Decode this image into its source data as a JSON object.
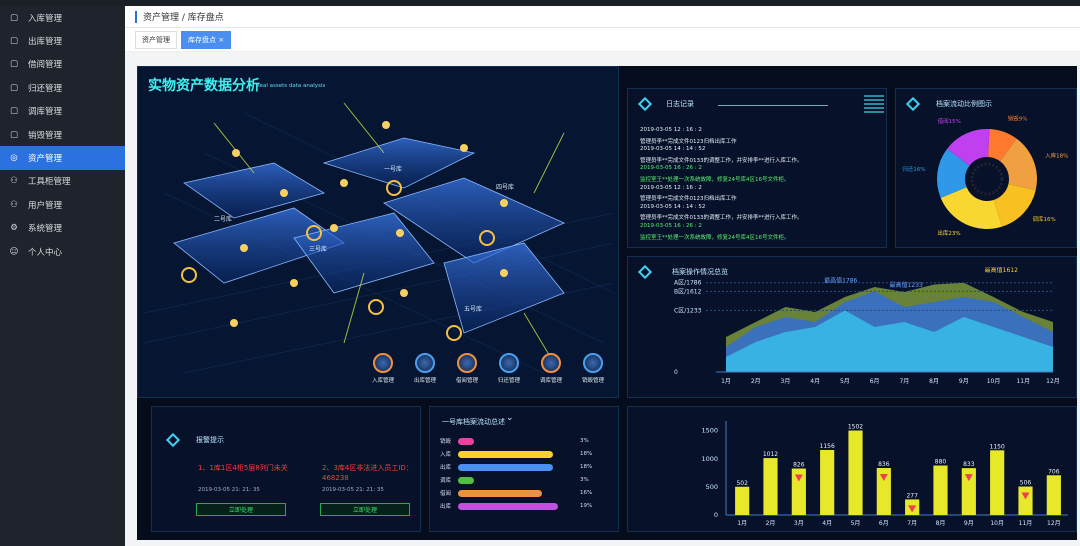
{
  "sidebar": {
    "items": [
      {
        "label": "入库管理",
        "icon": "box-icon"
      },
      {
        "label": "出库管理",
        "icon": "box-icon"
      },
      {
        "label": "借阅管理",
        "icon": "box-icon"
      },
      {
        "label": "归还管理",
        "icon": "box-icon"
      },
      {
        "label": "调库管理",
        "icon": "box-icon"
      },
      {
        "label": "销毁管理",
        "icon": "box-icon"
      },
      {
        "label": "资产管理",
        "icon": "asset-icon",
        "active": true
      },
      {
        "label": "工具柜管理",
        "icon": "user-icon"
      },
      {
        "label": "用户管理",
        "icon": "user-icon"
      },
      {
        "label": "系统管理",
        "icon": "gear-icon"
      },
      {
        "label": "个人中心",
        "icon": "person-icon"
      }
    ]
  },
  "breadcrumb": "资产管理 / 库存盘点",
  "tabs": [
    {
      "label": "资产管理"
    },
    {
      "label": "库存盘点 ×",
      "active": true
    }
  ],
  "dashboard": {
    "title": "实物资产数据分析",
    "subtitle": "Real assets data analysis",
    "map_labels": [
      "一号库",
      "二号库",
      "三号库",
      "四号库",
      "五号库"
    ],
    "map_buttons": [
      "入库管理",
      "出库管理",
      "借阅管理",
      "归还管理",
      "调库管理",
      "销毁管理"
    ],
    "log": {
      "title": "日志记录",
      "lines": [
        {
          "t": "2019-03-05  12 : 16 : 2",
          "g": false
        },
        {
          "t": "管理员李**完成文件0123归档出库工作",
          "g": false
        },
        {
          "t": "2019-03-05  14 : 14 : 52",
          "g": false
        },
        {
          "t": "管理员李**完成文件0133的调整工作，并安排李**进行入库工作。",
          "g": false
        },
        {
          "t": "2019-03-05  16 : 26 : 2",
          "g": true
        },
        {
          "t": "监控室王**处理一次系统故障，修复24号库4区16号文件柜。",
          "g": true
        },
        {
          "t": "2019-03-05  12 : 16 : 2",
          "g": false
        },
        {
          "t": "管理员李**完成文件0123归档出库工作",
          "g": false
        },
        {
          "t": "2019-03-05  14 : 14 : 52",
          "g": false
        },
        {
          "t": "管理员李**完成文件0133的调整工作，并安排李**进行入库工作。",
          "g": false
        },
        {
          "t": "2019-03-05  16 : 26 : 2",
          "g": true
        },
        {
          "t": "监控室王**处理一次系统故障，修复24号库4区16号文件柜。",
          "g": true
        }
      ]
    },
    "pie_title": "档案流动比例图示",
    "line_title": "档案操作情况总览",
    "warn": {
      "title": "报警提示",
      "items": [
        {
          "text": "1、1库1区4柜5层8列门未关",
          "time": "2019-03-05  21: 21: 35",
          "btn": "立即处理"
        },
        {
          "text": "2、3库4区非法进入员工ID：468238",
          "time": "2019-03-05  21: 21: 35",
          "btn": "立即处理"
        }
      ]
    },
    "hbar_title": "一号库档案流动总述"
  },
  "chart_data": [
    {
      "type": "pie",
      "title": "档案流动比例图示",
      "labels": [
        "销毁",
        "入库",
        "调库",
        "出库",
        "归还",
        "借阅"
      ],
      "values": [
        9,
        18,
        16,
        23,
        16,
        15
      ],
      "value_labels": [
        "销毁9%",
        "入库18%",
        "调库16%",
        "出库23%",
        "归还16%",
        "借阅15%"
      ],
      "colors": [
        "#ff7a2e",
        "#f0a040",
        "#f8c020",
        "#f8d830",
        "#3098e8",
        "#c040f0"
      ]
    },
    {
      "type": "area",
      "title": "档案操作情况总览",
      "categories": [
        "1月",
        "2月",
        "3月",
        "4月",
        "5月",
        "6月",
        "7月",
        "8月",
        "9月",
        "10月",
        "11月",
        "12月"
      ],
      "ytick_labels": [
        "A区/1786",
        "B区/1612",
        "C区/1233",
        "0"
      ],
      "annotations": [
        "最高值1786",
        "最高值1233",
        "最高值1612"
      ],
      "series": [
        {
          "values": [
            700,
            1000,
            1300,
            1200,
            1500,
            1700,
            1600,
            1750,
            1786,
            1500,
            1200,
            1000
          ]
        },
        {
          "values": [
            500,
            900,
            1100,
            1000,
            1400,
            1612,
            1300,
            1400,
            1500,
            1400,
            1100,
            800
          ]
        },
        {
          "values": [
            300,
            600,
            800,
            900,
            1233,
            900,
            1000,
            800,
            1100,
            900,
            700,
            500
          ]
        }
      ]
    },
    {
      "type": "bar",
      "categories": [
        "1月",
        "2月",
        "3月",
        "4月",
        "5月",
        "6月",
        "7月",
        "8月",
        "9月",
        "10月",
        "11月",
        "12月"
      ],
      "values": [
        502,
        1012,
        826,
        1156,
        1502,
        836,
        277,
        880,
        833,
        1150,
        506,
        706
      ],
      "down_arrows": [
        false,
        false,
        true,
        false,
        false,
        true,
        true,
        false,
        true,
        false,
        true,
        false
      ],
      "yticks": [
        0,
        500,
        1000,
        1500
      ],
      "ylim": [
        0,
        1600
      ]
    },
    {
      "type": "bar",
      "title": "一号库档案流动总述",
      "orientation": "horizontal",
      "categories": [
        "销毁",
        "入库",
        "出库",
        "调库",
        "借阅",
        "出库"
      ],
      "values": [
        3,
        18,
        18,
        3,
        16,
        19
      ],
      "value_labels": [
        "3%",
        "18%",
        "18%",
        "3%",
        "16%",
        "19%"
      ],
      "colors": [
        "#f040a0",
        "#f8d030",
        "#4a90f0",
        "#50c040",
        "#f09040",
        "#c050e0"
      ]
    }
  ]
}
